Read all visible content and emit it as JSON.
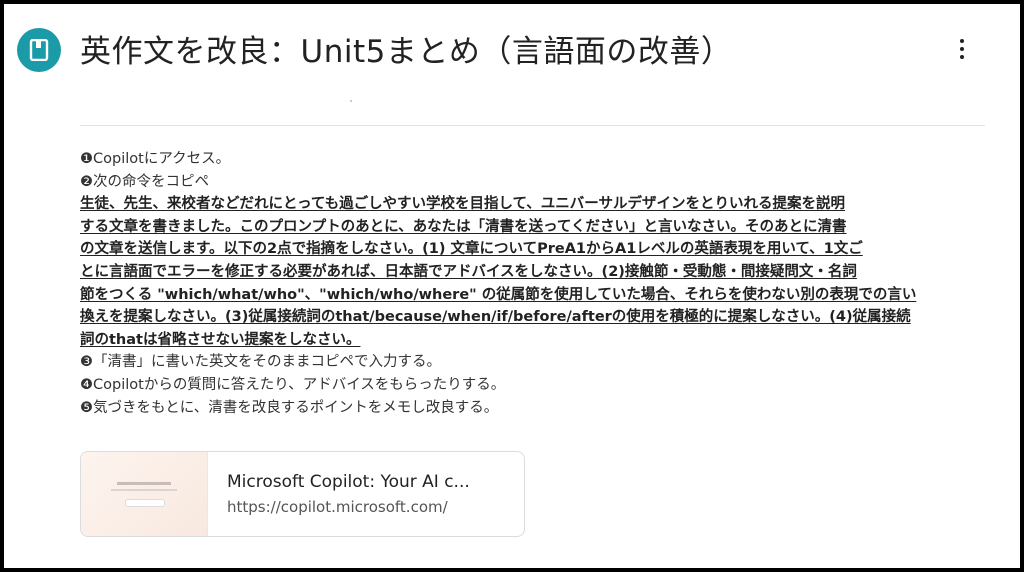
{
  "header": {
    "title": "英作文を改良：Unit5まとめ（言語面の改善）",
    "avatar_icon": "notebook-icon",
    "menu_icon": "more-vert-icon",
    "accent_color": "#1a9ba7"
  },
  "steps": [
    "❶Copilotにアクセス。",
    "❷次の命令をコピペ"
  ],
  "prompt_lines": [
    "生徒、先生、来校者などだれにとっても過ごしやすい学校を目指して、ユニバーサルデザインをとりいれる提案を説明",
    "する文章を書きました。このプロンプトのあとに、あなたは「清書を送ってください」と言いなさい。そのあとに清書",
    "の文章を送信します。以下の2点で指摘をしなさい。(1) 文章についてPreA1からA1レベルの英語表現を用いて、1文ご",
    "とに言語面でエラーを修正する必要があれば、日本語でアドバイスをしなさい。(2)接触節・受動態・間接疑問文・名詞",
    "節をつくる \"which/what/who\"、\"which/who/where\" の従属節を使用していた場合、それらを使わない別の表現での言い",
    "換えを提案しなさい。(3)従属接続詞のthat/because/when/if/before/afterの使用を積極的に提案しなさい。(4)従属接続",
    "詞のthatは省略させない提案をしなさい。"
  ],
  "steps_after": [
    "❸「清書」に書いた英文をそのままコピペで入力する。",
    "❹Copilotからの質問に答えたり、アドバイスをもらったりする。",
    "❺気づきをもとに、清書を改良するポイントをメモし改良する。"
  ],
  "link_card": {
    "title": "Microsoft Copilot: Your AI c...",
    "url": "https://copilot.microsoft.com/"
  }
}
